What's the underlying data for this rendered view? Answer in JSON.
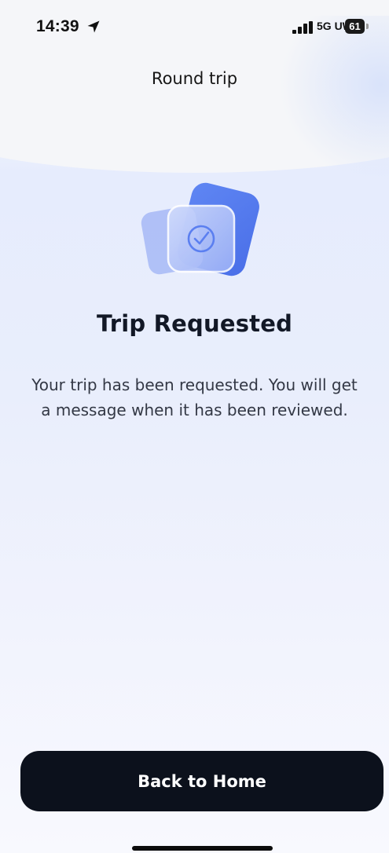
{
  "status_bar": {
    "time": "14:39",
    "location_icon": "location-arrow-icon",
    "signal_icon": "cellular-signal-icon",
    "network": "5G UW",
    "battery_level": "61"
  },
  "nav": {
    "title": "Round trip"
  },
  "confirmation": {
    "icon": "check-circle-icon",
    "title": "Trip Requested",
    "message": "Your trip has been requested. You will get a message when it has been reviewed."
  },
  "actions": {
    "back_home_label": "Back to Home"
  },
  "colors": {
    "accent": "#5b7ff0",
    "button_bg": "#0c111c",
    "button_text": "#ffffff"
  }
}
